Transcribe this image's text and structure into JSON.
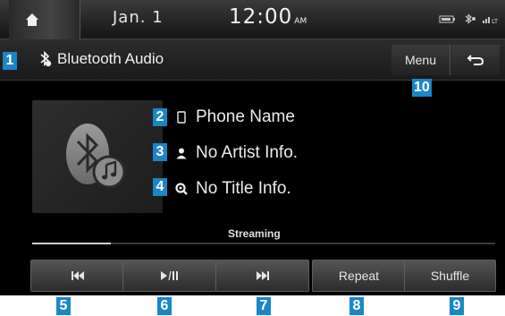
{
  "status_bar": {
    "date": "Jan.  1",
    "time": "12:00",
    "ampm": "AM"
  },
  "title_bar": {
    "title": "Bluetooth Audio",
    "menu_label": "Menu"
  },
  "track_info": {
    "phone_name": "Phone Name",
    "artist": "No Artist Info.",
    "title": "No Title Info."
  },
  "playback": {
    "status": "Streaming",
    "progress": 0.17
  },
  "controls": {
    "repeat_label": "Repeat",
    "shuffle_label": "Shuffle"
  },
  "callouts": [
    "1",
    "2",
    "3",
    "4",
    "5",
    "6",
    "7",
    "8",
    "9",
    "10"
  ],
  "colors": {
    "callout_blue": "#1a86c8",
    "screen_bg": "#000000",
    "button_top": "#545454",
    "button_bottom": "#2c2c2c"
  },
  "icons": {
    "home": "home-icon",
    "bluetooth": "bluetooth-icon",
    "back": "back-arrow-icon",
    "phone": "phone-icon",
    "artist": "person-icon",
    "title": "music-search-icon",
    "previous": "skip-previous-icon",
    "play_pause": "play-pause-icon",
    "next": "skip-next-icon"
  }
}
